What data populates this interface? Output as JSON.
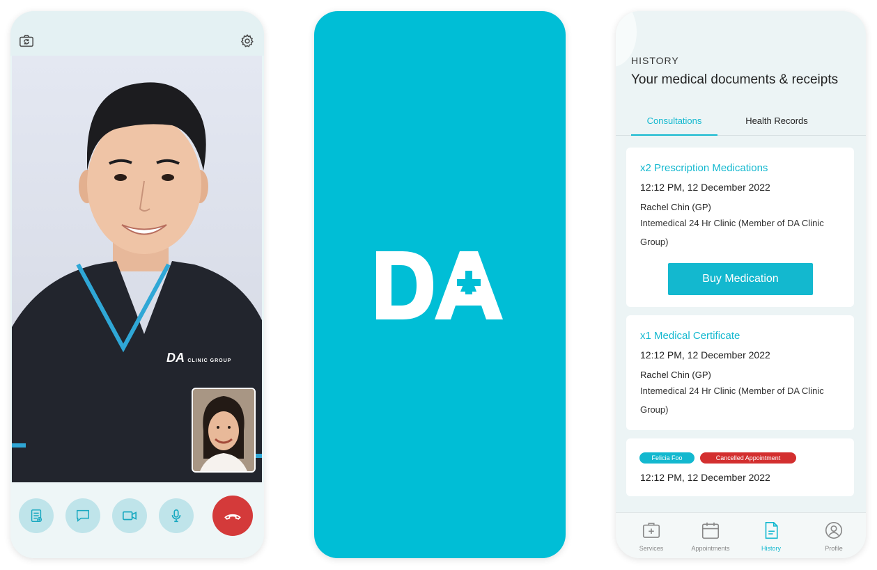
{
  "video_call": {
    "icons": {
      "flip": "camera-flip-icon",
      "settings": "gear-icon"
    },
    "scrub_text": "DA",
    "scrub_text_small": "CLINIC GROUP",
    "controls": [
      "document-icon",
      "chat-icon",
      "video-camera-icon",
      "microphone-icon",
      "end-call-icon"
    ],
    "colors": {
      "end_call": "#d43a3a",
      "control_bg": "#bfe4ea"
    }
  },
  "splash": {
    "logo_text": "DA",
    "background": "#00bed6"
  },
  "history": {
    "section_label": "HISTORY",
    "title": "Your medical documents & receipts",
    "tabs": [
      {
        "label": "Consultations",
        "active": true
      },
      {
        "label": "Health Records",
        "active": false
      }
    ],
    "cards": [
      {
        "title": "x2 Prescription Medications",
        "time": "12:12 PM, 12 December 2022",
        "doctor": "Rachel Chin (GP)",
        "clinic": "Intemedical 24 Hr Clinic (Member of DA Clinic Group)",
        "button": "Buy Medication"
      },
      {
        "title": "x1 Medical Certificate",
        "time": "12:12 PM, 12 December 2022",
        "doctor": "Rachel Chin (GP)",
        "clinic": "Intemedical 24 Hr Clinic (Member of DA Clinic Group)"
      },
      {
        "tags": [
          "Felicia Foo",
          "Cancelled Appointment"
        ],
        "time": "12:12 PM, 12 December 2022"
      }
    ],
    "nav": [
      {
        "label": "Services",
        "icon": "medical-kit-icon",
        "active": false
      },
      {
        "label": "Appointments",
        "icon": "calendar-icon",
        "active": false
      },
      {
        "label": "History",
        "icon": "document-icon",
        "active": true
      },
      {
        "label": "Profile",
        "icon": "user-icon",
        "active": false
      }
    ],
    "colors": {
      "accent": "#13b8cf",
      "cancelled": "#d32f2f"
    }
  }
}
